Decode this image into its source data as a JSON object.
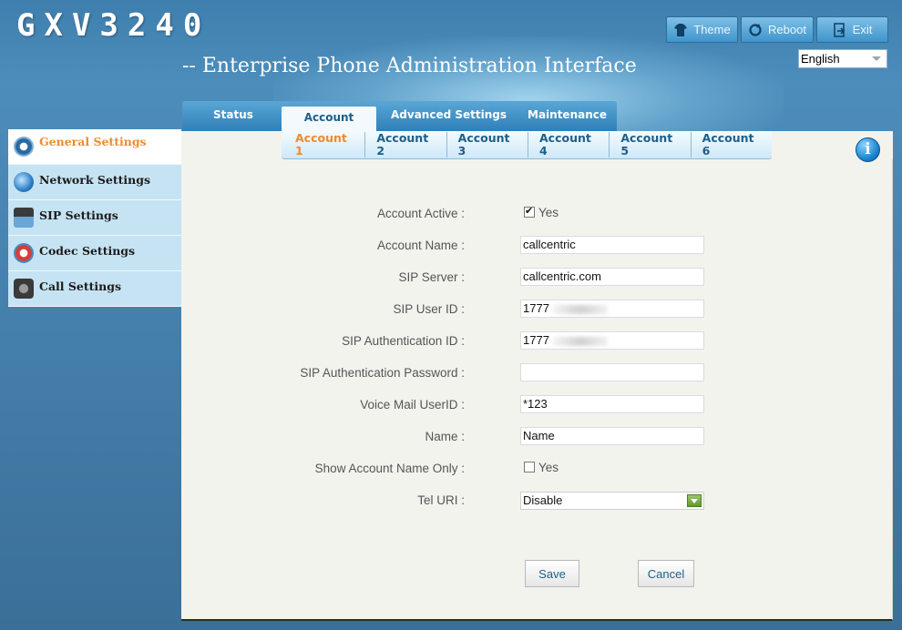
{
  "header": {
    "logo": "GXV3240",
    "subtitle": "-- Enterprise Phone Administration Interface",
    "buttons": {
      "theme": "Theme",
      "reboot": "Reboot",
      "exit": "Exit"
    },
    "language": "English"
  },
  "tabs": {
    "status": "Status",
    "account": "Account",
    "advanced": "Advanced Settings",
    "maintenance": "Maintenance"
  },
  "subtabs": [
    "Account 1",
    "Account 2",
    "Account 3",
    "Account 4",
    "Account 5",
    "Account 6"
  ],
  "sidebar": {
    "items": [
      {
        "label": "General Settings"
      },
      {
        "label": "Network Settings"
      },
      {
        "label": "SIP Settings"
      },
      {
        "label": "Codec Settings"
      },
      {
        "label": "Call Settings"
      }
    ]
  },
  "form": {
    "account_active": {
      "label": "Account Active :",
      "checked": true,
      "option": "Yes"
    },
    "account_name": {
      "label": "Account Name :",
      "value": "callcentric"
    },
    "sip_server": {
      "label": "SIP Server :",
      "value": "callcentric.com"
    },
    "sip_user_id": {
      "label": "SIP User ID :",
      "value": "1777"
    },
    "sip_auth_id": {
      "label": "SIP Authentication ID :",
      "value": "1777"
    },
    "sip_auth_password": {
      "label": "SIP Authentication Password :",
      "value": ""
    },
    "voice_mail_userid": {
      "label": "Voice Mail UserID :",
      "value": "*123"
    },
    "name": {
      "label": "Name :",
      "value": "Name"
    },
    "show_account_name_only": {
      "label": "Show Account Name Only :",
      "checked": false,
      "option": "Yes"
    },
    "tel_uri": {
      "label": "Tel URI :",
      "value": "Disable"
    }
  },
  "actions": {
    "save": "Save",
    "cancel": "Cancel"
  },
  "colors": {
    "accent": "#f08a2b",
    "tab_blue": "#2f80b8",
    "sidebar_bg": "#c6e3f3"
  }
}
